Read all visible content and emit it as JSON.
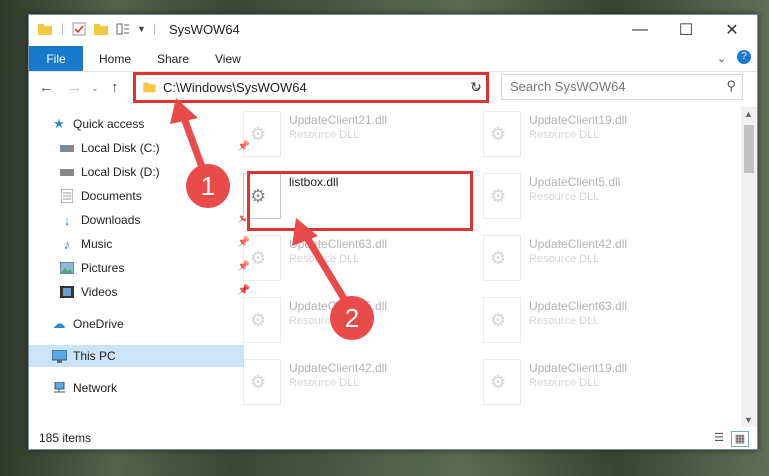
{
  "window": {
    "title": "SysWOW64"
  },
  "ribbon": {
    "file": "File",
    "tabs": [
      "Home",
      "Share",
      "View"
    ]
  },
  "address": {
    "path": "C:\\Windows\\SysWOW64"
  },
  "search": {
    "placeholder": "Search SysWOW64"
  },
  "sidebar": {
    "items": [
      {
        "label": "Quick access",
        "icon": "star-icon"
      },
      {
        "label": "Local Disk (C:)",
        "icon": "drive-icon"
      },
      {
        "label": "Local Disk (D:)",
        "icon": "drive-icon"
      },
      {
        "label": "Documents",
        "icon": "documents-icon"
      },
      {
        "label": "Downloads",
        "icon": "download-icon"
      },
      {
        "label": "Music",
        "icon": "music-icon"
      },
      {
        "label": "Pictures",
        "icon": "pictures-icon"
      },
      {
        "label": "Videos",
        "icon": "videos-icon"
      },
      {
        "label": "OneDrive",
        "icon": "cloud-icon"
      },
      {
        "label": "This PC",
        "icon": "computer-icon"
      },
      {
        "label": "Network",
        "icon": "network-icon"
      }
    ]
  },
  "files": [
    {
      "name": "UpdateClient21.dll",
      "type": "Resource DLL"
    },
    {
      "name": "UpdateClient19.dll",
      "type": "Resource DLL"
    },
    {
      "name": "listbox.dll",
      "type": ""
    },
    {
      "name": "UpdateClient5.dll",
      "type": "Resource DLL"
    },
    {
      "name": "UpdateClient63.dll",
      "type": "Resource DLL"
    },
    {
      "name": "UpdateClient42.dll",
      "type": "Resource DLL"
    },
    {
      "name": "UpdateClient65.dll",
      "type": "Resource DLL"
    },
    {
      "name": "UpdateClient63.dll",
      "type": "Resource DLL"
    },
    {
      "name": "UpdateClient42.dll",
      "type": "Resource DLL"
    },
    {
      "name": "UpdateClient19.dll",
      "type": "Resource DLL"
    }
  ],
  "status": {
    "count": "185 items"
  },
  "annotations": {
    "one": "1",
    "two": "2"
  },
  "colors": {
    "accent": "#1979ca",
    "highlight": "#d33333",
    "badge": "#e94b4b"
  }
}
